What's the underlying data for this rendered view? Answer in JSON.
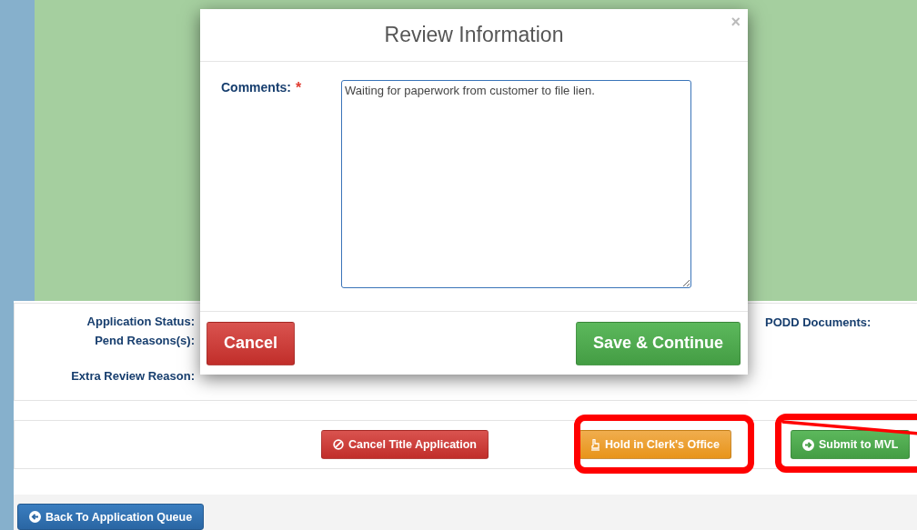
{
  "page": {
    "info_labels": [
      {
        "label": "Application Status:"
      },
      {
        "label": "Pend Reasons(s):"
      },
      {
        "label": "Extra Review Reason:"
      }
    ],
    "side_label": "PODD Documents:",
    "actions": [
      {
        "label": "Cancel Title Application",
        "kind": "danger"
      },
      {
        "label": "Hold in Clerk's Office",
        "kind": "warning"
      },
      {
        "label": "Submit to MVL",
        "kind": "success"
      }
    ],
    "back_button": "Back To Application Queue"
  },
  "modal": {
    "title": "Review Information",
    "close": "×",
    "field_label": "Comments:",
    "required_mark": "*",
    "comments": "Waiting for paperwork from customer to file lien.",
    "buttons": [
      {
        "label": "Cancel",
        "kind": "danger"
      },
      {
        "label": "Save & Continue",
        "kind": "success"
      }
    ]
  }
}
